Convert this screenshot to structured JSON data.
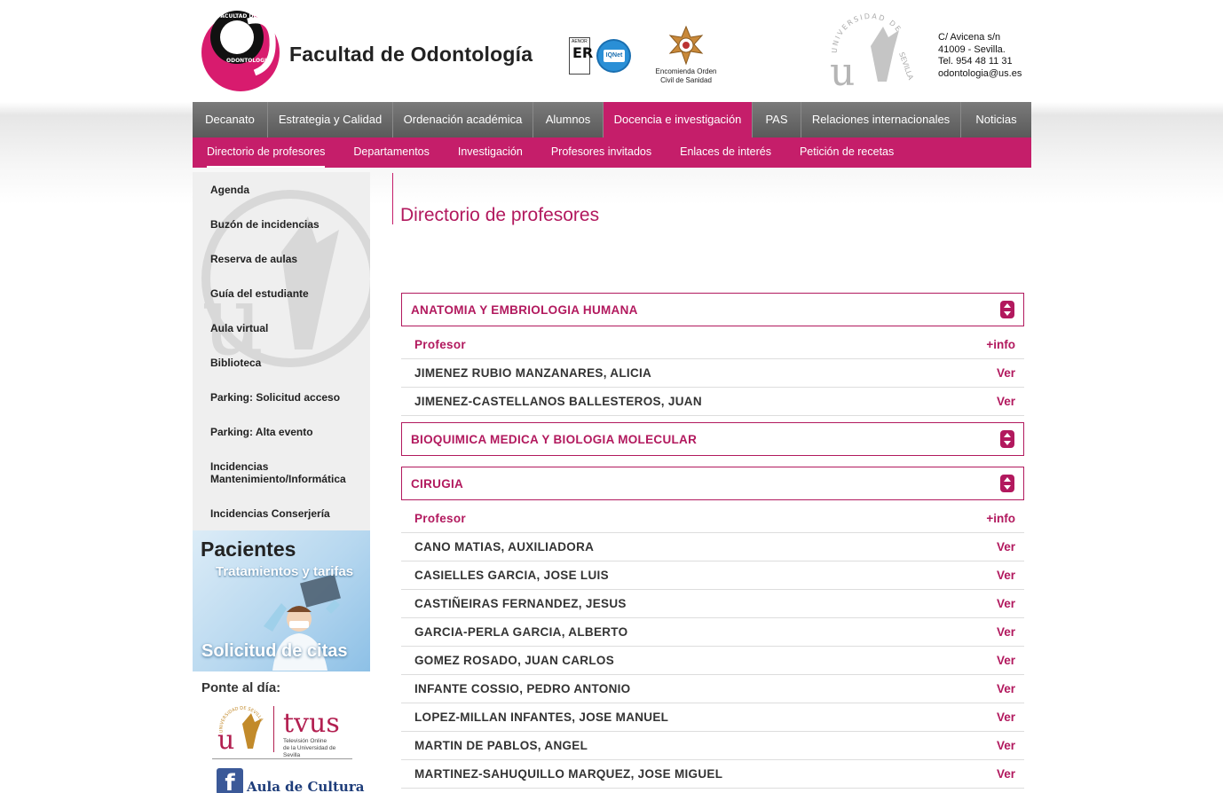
{
  "header": {
    "site_title": "Facultad de Odontología",
    "aenor_label": "AENOR",
    "aenor_mark": "ER",
    "iqnet_label": "IQNet",
    "medal_caption_1": "Encomienda Orden",
    "medal_caption_2": "Civil de Sanidad",
    "address": {
      "line1": "C/ Avicena s/n",
      "line2": "41009 - Sevilla.",
      "line3": "Tel. 954 48 11 31",
      "line4": "odontologia@us.es"
    }
  },
  "main_nav": [
    {
      "label": "Decanato"
    },
    {
      "label": "Estrategia y Calidad"
    },
    {
      "label": "Ordenación académica"
    },
    {
      "label": "Alumnos"
    },
    {
      "label": "Docencia e investigación"
    },
    {
      "label": "PAS"
    },
    {
      "label": "Relaciones internacionales"
    },
    {
      "label": "Noticias"
    }
  ],
  "sub_nav": [
    {
      "label": "Directorio de profesores"
    },
    {
      "label": "Departamentos"
    },
    {
      "label": "Investigación"
    },
    {
      "label": "Profesores invitados"
    },
    {
      "label": "Enlaces de interés"
    },
    {
      "label": "Petición de recetas"
    }
  ],
  "sidebar": {
    "items": [
      {
        "label": "Agenda"
      },
      {
        "label": "Buzón de incidencias"
      },
      {
        "label": "Reserva de aulas"
      },
      {
        "label": "Guía del estudiante"
      },
      {
        "label": "Aula virtual"
      },
      {
        "label": "Biblioteca"
      },
      {
        "label": "Parking: Solicitud acceso"
      },
      {
        "label": "Parking: Alta evento"
      },
      {
        "label": "Incidencias Mantenimiento/Informática"
      },
      {
        "label": "Incidencias Conserjería"
      }
    ],
    "promo": {
      "title": "Pacientes",
      "subtitle": "Tratamientos y tarifas",
      "cta": "Solicitud de citas"
    },
    "ponte_label": "Ponte al día:",
    "tvus": {
      "name": "tvus",
      "caption_1": "Televisión Online",
      "caption_2": "de la Universidad de Sevilla"
    },
    "aula": {
      "fb_glyph": "f",
      "label": "Aula de Cultura"
    }
  },
  "content": {
    "page_title": "Directorio de profesores",
    "col_profesor": "Profesor",
    "col_info": "+info",
    "ver_label": "Ver",
    "departments": [
      {
        "name": "ANATOMIA Y EMBRIOLOGIA HUMANA",
        "expanded": true,
        "professors": [
          "JIMENEZ RUBIO MANZANARES, ALICIA",
          "JIMENEZ-CASTELLANOS BALLESTEROS, JUAN"
        ]
      },
      {
        "name": "BIOQUIMICA MEDICA Y BIOLOGIA MOLECULAR",
        "expanded": false,
        "professors": []
      },
      {
        "name": "CIRUGIA",
        "expanded": true,
        "professors": [
          "CANO MATIAS, AUXILIADORA",
          "CASIELLES GARCIA, JOSE LUIS",
          "CASTIÑEIRAS FERNANDEZ, JESUS",
          "GARCIA-PERLA GARCIA, ALBERTO",
          "GOMEZ ROSADO, JUAN CARLOS",
          "INFANTE COSSIO, PEDRO ANTONIO",
          "LOPEZ-MILLAN INFANTES, JOSE MANUEL",
          "MARTIN DE PABLOS, ANGEL",
          "MARTINEZ-SAHUQUILLO MARQUEZ, JOSE MIGUEL"
        ]
      }
    ]
  }
}
